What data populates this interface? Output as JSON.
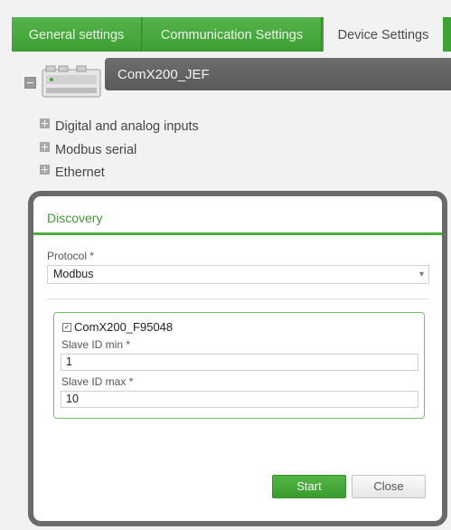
{
  "tabs": [
    {
      "label": "General settings",
      "active": false
    },
    {
      "label": "Communication Settings",
      "active": false
    },
    {
      "label": "Device Settings",
      "active": true
    }
  ],
  "device": {
    "name": "ComX200_JEF",
    "icon": "device-module-icon"
  },
  "tree": [
    "Digital and analog inputs",
    "Modbus serial",
    "Ethernet"
  ],
  "dialog": {
    "title": "Discovery",
    "protocol_label": "Protocol *",
    "protocol_value": "Modbus",
    "device_check_label": "ComX200_F95048",
    "device_checked": true,
    "slave_min_label": "Slave ID min *",
    "slave_min_value": "1",
    "slave_max_label": "Slave ID max *",
    "slave_max_value": "10",
    "start_label": "Start",
    "close_label": "Close"
  },
  "colors": {
    "accent": "#3ea335",
    "header": "#5f5f5f"
  }
}
